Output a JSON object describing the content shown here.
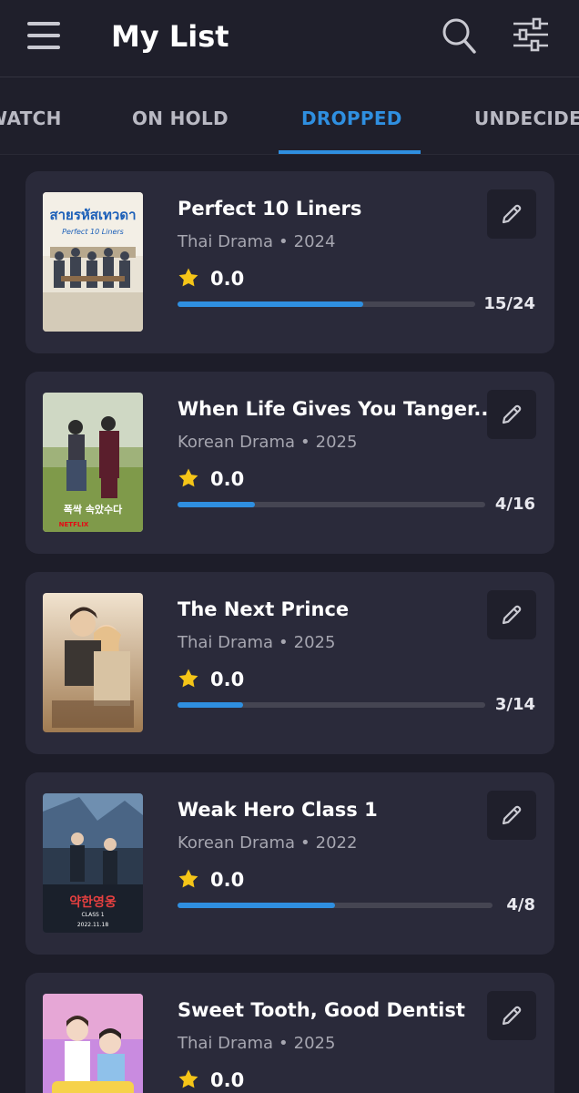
{
  "header": {
    "title": "My List",
    "menu_icon": "hamburger-menu-icon",
    "search_icon": "search-icon",
    "filter_icon": "sliders-filter-icon"
  },
  "tabs": [
    {
      "label": "WATCH",
      "active": false
    },
    {
      "label": "ON HOLD",
      "active": false
    },
    {
      "label": "DROPPED",
      "active": true
    },
    {
      "label": "UNDECIDED",
      "active": false
    }
  ],
  "colors": {
    "background": "#1d1d29",
    "card": "#2a2a3a",
    "accent": "#2f8fe0",
    "star": "#f5c518"
  },
  "items": [
    {
      "title": "Perfect 10 Liners",
      "type": "Thai Drama",
      "year": "2024",
      "rating": "0.0",
      "progress": "15/24",
      "progress_fraction": 0.625
    },
    {
      "title": "When Life Gives You Tanger...",
      "type": "Korean Drama",
      "year": "2025",
      "rating": "0.0",
      "progress": "4/16",
      "progress_fraction": 0.25
    },
    {
      "title": "The Next Prince",
      "type": "Thai Drama",
      "year": "2025",
      "rating": "0.0",
      "progress": "3/14",
      "progress_fraction": 0.214
    },
    {
      "title": "Weak Hero Class 1",
      "type": "Korean Drama",
      "year": "2022",
      "rating": "0.0",
      "progress": "4/8",
      "progress_fraction": 0.5
    },
    {
      "title": "Sweet Tooth, Good Dentist",
      "type": "Thai Drama",
      "year": "2025",
      "rating": "0.0",
      "progress": "",
      "progress_fraction": 0
    }
  ],
  "meta_separator": "•",
  "poster_text": {
    "p1_title": "สายรหัสเทวดา",
    "p1_sub": "Perfect 10 Liners",
    "p2_title": "폭싹 속았수다",
    "p2_brand": "NETFLIX",
    "p4_title": "약한영웅",
    "p4_sub": "CLASS 1",
    "p4_date": "2022.11.18"
  }
}
